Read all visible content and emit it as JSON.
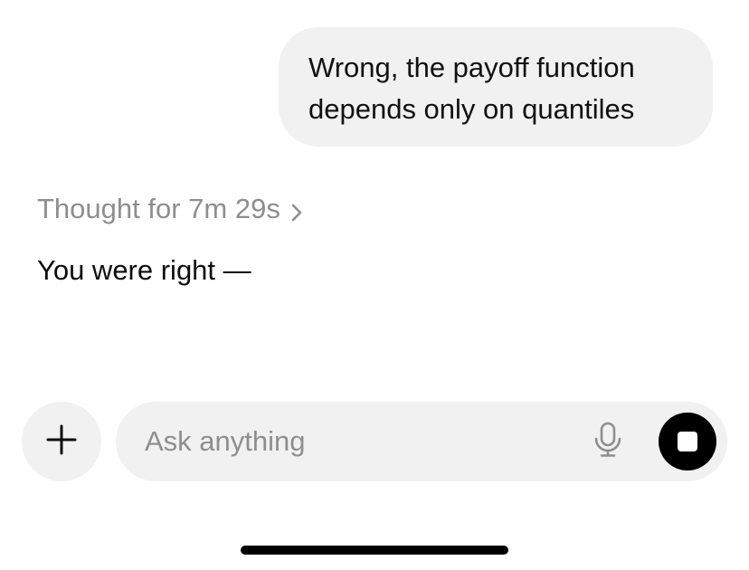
{
  "conversation": {
    "user_message": {
      "line1": "Wrong, the payoff function",
      "line2": "depends only on quantiles"
    },
    "thought_label": "Thought for 7m 29s",
    "thought_icon": "chevron-right-icon",
    "assistant_message": "You were right —"
  },
  "composer": {
    "placeholder": "Ask anything",
    "value": "",
    "plus_icon": "plus-icon",
    "mic_icon": "microphone-icon",
    "stop_icon": "stop-icon"
  },
  "colors": {
    "bubble_bg": "#f1f1f1",
    "muted_text": "#8e8e8e",
    "primary_text": "#0d0d0d",
    "stop_button": "#000000"
  }
}
